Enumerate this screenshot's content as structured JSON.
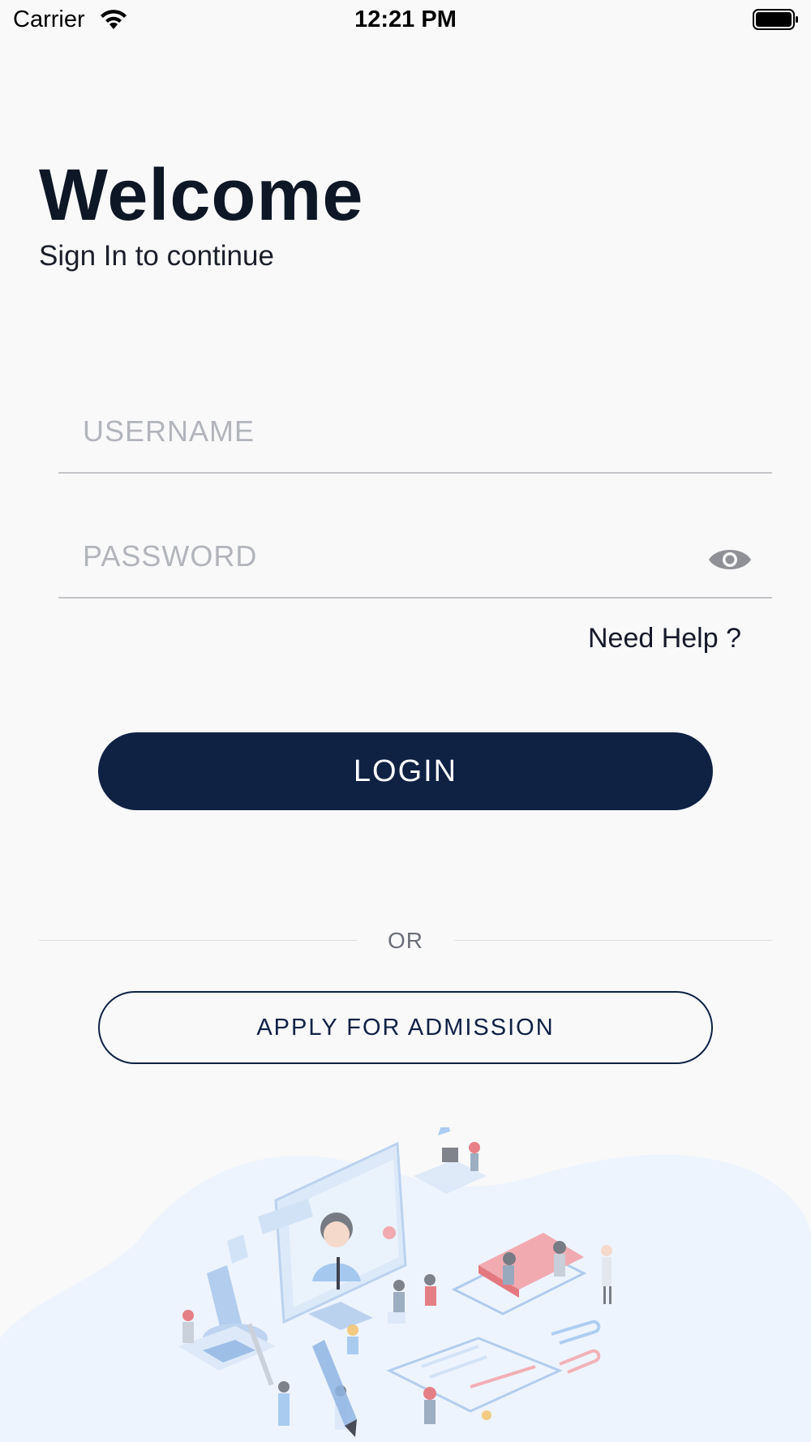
{
  "status_bar": {
    "carrier": "Carrier",
    "time": "12:21 PM"
  },
  "header": {
    "title": "Welcome",
    "subtitle": "Sign In to continue"
  },
  "form": {
    "username_placeholder": "USERNAME",
    "username_value": "",
    "password_placeholder": "PASSWORD",
    "password_value": "",
    "need_help": "Need Help ?"
  },
  "actions": {
    "login_label": "LOGIN",
    "divider_label": "OR",
    "apply_label": "APPLY FOR ADMISSION"
  },
  "colors": {
    "primary": "#0f2244",
    "background": "#f9f9fa",
    "placeholder": "#b2b5bb",
    "illustration_blob": "#eef4fd"
  },
  "icons": [
    "wifi-icon",
    "battery-icon",
    "eye-icon"
  ]
}
